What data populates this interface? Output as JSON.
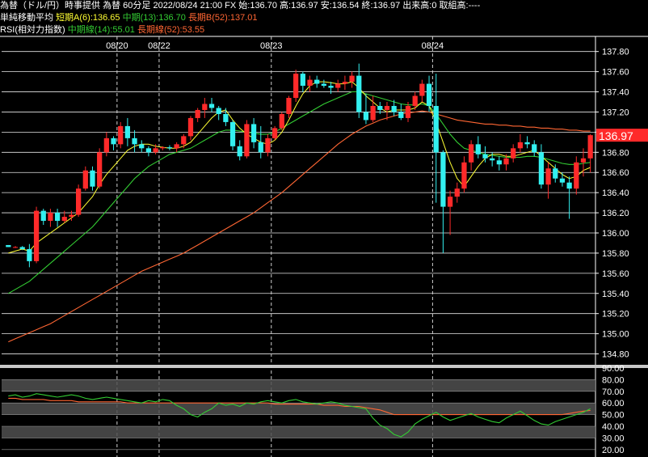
{
  "header": {
    "line1": "為替（ドル/円）時事提供 為替 60分足 2022/08/24 21:00 FX 始:136.70 高:136.97 安:136.54 終:136.97 出来高:0 取組高:----",
    "ma_label": "単純移動平均",
    "ma_short": "短期A(6):136.65",
    "ma_mid": "中期(13):136.70",
    "ma_long": "長期B(52):137.01",
    "rsi_label": "RSI(相対力指数)",
    "rsi_mid": "中期線(14):55.01",
    "rsi_long": "長期線(52):53.55"
  },
  "colors": {
    "background": "#000000",
    "up": "#ff2a2a",
    "down": "#33f0f0",
    "ma_short": "#ffff33",
    "ma_mid": "#33cc33",
    "ma_long": "#ff6633",
    "last_price_bg": "#ff2a2a",
    "grid": "#ffffff",
    "rsi_band": "#505050"
  },
  "chart_data": [
    {
      "type": "candlestick",
      "price_axis_ticks": [
        "137.80",
        "137.60",
        "137.40",
        "137.20",
        "137.00",
        "136.80",
        "136.60",
        "136.40",
        "136.20",
        "136.00",
        "135.80",
        "135.60",
        "135.40",
        "135.20",
        "135.00",
        "134.80"
      ],
      "ylim": [
        134.7,
        137.95
      ],
      "date_labels": [
        {
          "label": "08/20",
          "bar": 16
        },
        {
          "label": "08/22",
          "bar": 22
        },
        {
          "label": "08/23",
          "bar": 38
        },
        {
          "label": "08/24",
          "bar": 61
        }
      ],
      "last_price": "136.97",
      "candles": [
        [
          135.88,
          135.88,
          135.86,
          135.86
        ],
        [
          135.86,
          135.87,
          135.85,
          135.86
        ],
        [
          135.86,
          135.87,
          135.83,
          135.84
        ],
        [
          135.84,
          135.89,
          135.66,
          135.72
        ],
        [
          135.72,
          136.26,
          135.7,
          136.22
        ],
        [
          136.22,
          136.24,
          136.08,
          136.12
        ],
        [
          136.12,
          136.24,
          136.06,
          136.2
        ],
        [
          136.2,
          136.24,
          136.06,
          136.12
        ],
        [
          136.12,
          136.22,
          136.1,
          136.16
        ],
        [
          136.16,
          136.22,
          136.12,
          136.18
        ],
        [
          136.18,
          136.48,
          136.16,
          136.44
        ],
        [
          136.44,
          136.66,
          136.42,
          136.62
        ],
        [
          136.62,
          136.66,
          136.42,
          136.46
        ],
        [
          136.46,
          136.84,
          136.44,
          136.8
        ],
        [
          136.8,
          137.0,
          136.76,
          136.94
        ],
        [
          136.94,
          136.96,
          136.82,
          136.88
        ],
        [
          136.88,
          137.1,
          136.84,
          137.06
        ],
        [
          137.06,
          137.14,
          136.86,
          136.94
        ],
        [
          136.94,
          137.02,
          136.8,
          136.88
        ],
        [
          136.88,
          136.92,
          136.8,
          136.84
        ],
        [
          136.84,
          136.86,
          136.76,
          136.8
        ],
        [
          136.8,
          136.88,
          136.78,
          136.84
        ],
        [
          136.84,
          136.86,
          136.82,
          136.85
        ],
        [
          136.85,
          136.87,
          136.82,
          136.84
        ],
        [
          136.84,
          136.9,
          136.8,
          136.88
        ],
        [
          136.88,
          136.98,
          136.84,
          136.96
        ],
        [
          136.96,
          137.16,
          136.92,
          137.14
        ],
        [
          137.14,
          137.24,
          137.1,
          137.22
        ],
        [
          137.22,
          137.34,
          137.14,
          137.28
        ],
        [
          137.28,
          137.34,
          137.2,
          137.24
        ],
        [
          137.24,
          137.26,
          137.12,
          137.18
        ],
        [
          137.18,
          137.24,
          137.06,
          137.1
        ],
        [
          137.1,
          137.12,
          136.82,
          136.86
        ],
        [
          136.86,
          136.92,
          136.72,
          136.76
        ],
        [
          136.76,
          137.12,
          136.74,
          137.08
        ],
        [
          137.08,
          137.14,
          136.84,
          136.9
        ],
        [
          136.9,
          137.06,
          136.74,
          136.8
        ],
        [
          136.8,
          136.98,
          136.76,
          136.94
        ],
        [
          136.94,
          137.06,
          136.92,
          137.04
        ],
        [
          137.04,
          137.2,
          137.02,
          137.18
        ],
        [
          137.18,
          137.36,
          137.14,
          137.34
        ],
        [
          137.34,
          137.62,
          137.3,
          137.58
        ],
        [
          137.58,
          137.6,
          137.4,
          137.46
        ],
        [
          137.46,
          137.56,
          137.4,
          137.52
        ],
        [
          137.52,
          137.56,
          137.44,
          137.48
        ],
        [
          137.48,
          137.52,
          137.44,
          137.46
        ],
        [
          137.46,
          137.5,
          137.38,
          137.44
        ],
        [
          137.44,
          137.52,
          137.4,
          137.48
        ],
        [
          137.48,
          137.56,
          137.42,
          137.5
        ],
        [
          137.5,
          137.6,
          137.44,
          137.56
        ],
        [
          137.56,
          137.68,
          137.14,
          137.2
        ],
        [
          137.2,
          137.38,
          137.08,
          137.12
        ],
        [
          137.12,
          137.36,
          137.1,
          137.26
        ],
        [
          137.26,
          137.3,
          137.18,
          137.22
        ],
        [
          137.22,
          137.3,
          137.12,
          137.26
        ],
        [
          137.26,
          137.32,
          137.16,
          137.2
        ],
        [
          137.2,
          137.28,
          137.12,
          137.14
        ],
        [
          137.14,
          137.3,
          137.1,
          137.26
        ],
        [
          137.26,
          137.4,
          137.22,
          137.36
        ],
        [
          137.36,
          137.52,
          137.3,
          137.48
        ],
        [
          137.48,
          137.56,
          137.2,
          137.26
        ],
        [
          137.26,
          137.58,
          136.3,
          136.8
        ],
        [
          136.8,
          136.82,
          135.8,
          136.26
        ],
        [
          136.26,
          136.42,
          135.98,
          136.36
        ],
        [
          136.36,
          136.5,
          136.3,
          136.44
        ],
        [
          136.44,
          136.76,
          136.4,
          136.7
        ],
        [
          136.7,
          136.92,
          136.62,
          136.88
        ],
        [
          136.88,
          136.96,
          136.74,
          136.78
        ],
        [
          136.78,
          136.86,
          136.7,
          136.74
        ],
        [
          136.74,
          136.8,
          136.66,
          136.72
        ],
        [
          136.72,
          136.76,
          136.62,
          136.68
        ],
        [
          136.68,
          136.78,
          136.62,
          136.74
        ],
        [
          136.74,
          136.88,
          136.7,
          136.84
        ],
        [
          136.84,
          136.98,
          136.8,
          136.9
        ],
        [
          136.9,
          136.96,
          136.84,
          136.88
        ],
        [
          136.88,
          136.92,
          136.76,
          136.8
        ],
        [
          136.8,
          136.88,
          136.44,
          136.48
        ],
        [
          136.48,
          136.7,
          136.34,
          136.64
        ],
        [
          136.64,
          136.68,
          136.5,
          136.54
        ],
        [
          136.54,
          136.6,
          136.46,
          136.5
        ],
        [
          136.5,
          136.56,
          136.14,
          136.44
        ],
        [
          136.44,
          136.76,
          136.38,
          136.7
        ],
        [
          136.7,
          136.84,
          136.56,
          136.74
        ],
        [
          136.74,
          136.98,
          136.6,
          136.97
        ]
      ],
      "ma_short": [
        135.8,
        135.82,
        135.84,
        135.82,
        135.9,
        135.95,
        136.0,
        136.05,
        136.1,
        136.15,
        136.2,
        136.28,
        136.36,
        136.48,
        136.58,
        136.66,
        136.74,
        136.82,
        136.86,
        136.88,
        136.88,
        136.86,
        136.85,
        136.84,
        136.84,
        136.86,
        136.9,
        136.98,
        137.06,
        137.14,
        137.2,
        137.22,
        137.12,
        137.04,
        136.98,
        136.94,
        136.9,
        136.88,
        136.92,
        137.0,
        137.12,
        137.26,
        137.38,
        137.46,
        137.5,
        137.5,
        137.49,
        137.48,
        137.48,
        137.5,
        137.44,
        137.36,
        137.3,
        137.24,
        137.2,
        137.22,
        137.22,
        137.22,
        137.24,
        137.3,
        137.26,
        137.1,
        136.9,
        136.7,
        136.54,
        136.46,
        136.56,
        136.66,
        136.74,
        136.78,
        136.78,
        136.76,
        136.76,
        136.78,
        136.8,
        136.82,
        136.76,
        136.7,
        136.64,
        136.58,
        136.54,
        136.56,
        136.62,
        136.65
      ],
      "ma_mid": [
        135.4,
        135.44,
        135.48,
        135.52,
        135.58,
        135.64,
        135.7,
        135.76,
        135.82,
        135.88,
        135.94,
        136.0,
        136.06,
        136.14,
        136.22,
        136.3,
        136.38,
        136.46,
        136.54,
        136.6,
        136.66,
        136.7,
        136.74,
        136.78,
        136.8,
        136.82,
        136.84,
        136.88,
        136.92,
        136.96,
        137.0,
        137.02,
        137.02,
        137.01,
        137.0,
        136.99,
        136.98,
        136.98,
        137.0,
        137.04,
        137.08,
        137.12,
        137.16,
        137.2,
        137.24,
        137.28,
        137.31,
        137.34,
        137.37,
        137.4,
        137.4,
        137.38,
        137.36,
        137.34,
        137.32,
        137.3,
        137.28,
        137.27,
        137.27,
        137.28,
        137.26,
        137.18,
        137.08,
        136.98,
        136.9,
        136.84,
        136.82,
        136.8,
        136.78,
        136.77,
        136.76,
        136.75,
        136.75,
        136.75,
        136.76,
        136.76,
        136.75,
        136.73,
        136.71,
        136.69,
        136.68,
        136.68,
        136.69,
        136.7
      ],
      "ma_long": [
        134.92,
        134.95,
        134.98,
        135.01,
        135.04,
        135.07,
        135.1,
        135.14,
        135.18,
        135.22,
        135.26,
        135.3,
        135.34,
        135.38,
        135.42,
        135.46,
        135.5,
        135.54,
        135.58,
        135.62,
        135.65,
        135.68,
        135.71,
        135.74,
        135.77,
        135.8,
        135.84,
        135.88,
        135.92,
        135.96,
        136.0,
        136.04,
        136.08,
        136.12,
        136.16,
        136.2,
        136.25,
        136.3,
        136.35,
        136.4,
        136.46,
        136.52,
        136.58,
        136.64,
        136.7,
        136.76,
        136.82,
        136.88,
        136.93,
        136.98,
        137.02,
        137.06,
        137.09,
        137.12,
        137.14,
        137.16,
        137.18,
        137.19,
        137.2,
        137.21,
        137.2,
        137.18,
        137.16,
        137.14,
        137.12,
        137.11,
        137.1,
        137.09,
        137.08,
        137.08,
        137.07,
        137.07,
        137.06,
        137.06,
        137.05,
        137.05,
        137.04,
        137.04,
        137.03,
        137.03,
        137.02,
        137.02,
        137.01,
        137.01
      ]
    },
    {
      "type": "line",
      "title": "RSI",
      "y_ticks": [
        "90.00",
        "80.00",
        "70.00",
        "60.00",
        "50.00",
        "40.00",
        "30.00",
        "20.00"
      ],
      "ylim": [
        15,
        90
      ],
      "bands": [
        [
          30,
          40
        ],
        [
          50,
          60
        ],
        [
          70,
          80
        ]
      ],
      "series": [
        {
          "name": "中期線(14)",
          "values": [
            66,
            67,
            65,
            66,
            68,
            67,
            66,
            65,
            66,
            67,
            66,
            64,
            63,
            64,
            65,
            64,
            63,
            62,
            61,
            60,
            62,
            61,
            63,
            62,
            58,
            55,
            50,
            48,
            52,
            55,
            60,
            58,
            59,
            57,
            60,
            59,
            61,
            62,
            61,
            60,
            62,
            63,
            61,
            60,
            59,
            60,
            61,
            60,
            58,
            57,
            56,
            55,
            47,
            41,
            38,
            33,
            31,
            35,
            42,
            46,
            49,
            52,
            48,
            45,
            47,
            49,
            51,
            48,
            46,
            44,
            43,
            47,
            50,
            53,
            49,
            45,
            42,
            41,
            44,
            46,
            48,
            50,
            52,
            55
          ]
        },
        {
          "name": "長期線(52)",
          "values": [
            64,
            64,
            63,
            63,
            63,
            63,
            62,
            62,
            62,
            62,
            61,
            61,
            61,
            61,
            61,
            61,
            61,
            60,
            60,
            60,
            60,
            60,
            60,
            60,
            60,
            60,
            60,
            60,
            60,
            60,
            60,
            60,
            60,
            60,
            60,
            60,
            60,
            60,
            59,
            59,
            59,
            59,
            59,
            59,
            59,
            58,
            58,
            58,
            57,
            57,
            57,
            56,
            55,
            54,
            52,
            50,
            50,
            50,
            50,
            50,
            50,
            50,
            50,
            50,
            50,
            50,
            50,
            50,
            50,
            50,
            50,
            50,
            50,
            50,
            50,
            50,
            50,
            50,
            50,
            50,
            51,
            52,
            53,
            53.55
          ]
        }
      ]
    }
  ]
}
